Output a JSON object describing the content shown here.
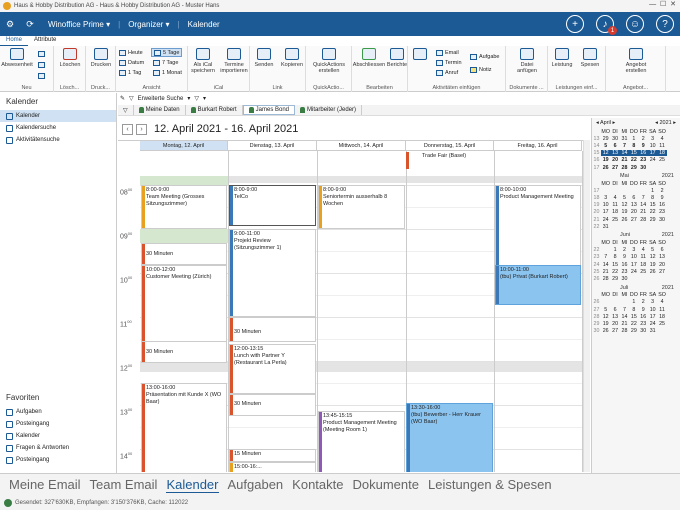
{
  "window": {
    "title": "Haus & Hobby Distribution AG - Haus & Hobby Distribution AG - Muster Hans"
  },
  "appbar": {
    "app": "Winoffice Prime",
    "section": "Organizer",
    "view": "Kalender",
    "notif_count": "1"
  },
  "ribbon_tabs": [
    "Home",
    "Attribute"
  ],
  "ribbon": {
    "neu": {
      "label": "Neu",
      "btn1": "Abwesenheit"
    },
    "losch": {
      "label": "Lösch...",
      "btn1": "Löschen"
    },
    "druck": {
      "label": "Druck...",
      "btn1": "Drucken"
    },
    "ansicht": {
      "label": "Ansicht",
      "items": [
        "Heute",
        "Datum",
        "1 Tag",
        "5 Tage",
        "7 Tage",
        "1 Monat"
      ]
    },
    "ical": {
      "label": "iCal",
      "btn1": "Als iCal speichern",
      "btn2": "Termine importieren"
    },
    "link": {
      "label": "Link",
      "btn1": "Senden",
      "btn2": "Kopieren"
    },
    "quickactions": {
      "label": "QuickActio...",
      "btn1": "QuickActions erstellen"
    },
    "bearbeiten": {
      "label": "Bearbeiten",
      "btn1": "Abschliessen",
      "btn2": "Berichte"
    },
    "aktivitaeten": {
      "label": "Aktivitäten einfügen",
      "items": [
        "Email",
        "Termin",
        "Anruf",
        "Aufgabe",
        "Notiz"
      ]
    },
    "dokumente": {
      "label": "Dokumente ...",
      "btn1": "Datei anfügen"
    },
    "leistungen": {
      "label": "Leistungen einf...",
      "btn1": "Leistung",
      "btn2": "Spesen"
    },
    "angebot": {
      "label": "Angebot...",
      "btn1": "Angebot erstellen"
    }
  },
  "toolbar": {
    "search": "Erweiterte Suche"
  },
  "filters": [
    "Meine Daten",
    "Burkart Robert",
    "James Bond",
    "Mitarbeiter (Jeder)"
  ],
  "sidebar": {
    "title": "Kalender",
    "items": [
      "Kalender",
      "Kalendersuche",
      "Aktivitätensuche"
    ],
    "fav_title": "Favoriten",
    "favs": [
      "Aufgaben",
      "Posteingang",
      "Kalender",
      "Fragen & Antworten",
      "Posteingang"
    ]
  },
  "calendar": {
    "range": "12. April 2021 - 16. April 2021",
    "days": [
      "Montag, 12. April",
      "Dienstag, 13. April",
      "Mittwoch, 14. April",
      "Donnerstag, 15. April",
      "Freitag, 16. April"
    ],
    "hours": [
      "08",
      "09",
      "10",
      "11",
      "12",
      "13",
      "14"
    ],
    "events": {
      "e1": {
        "time": "8:00-9:00",
        "text": "Team Meeting (Grosses Sitzungszimmer)"
      },
      "e2": {
        "time": "8:00-9:00",
        "text": "TelCo"
      },
      "e3": {
        "time": "8:00-9:00",
        "text": "Seniortermin ausserhalb 8 Wochen"
      },
      "e4": {
        "time": "8:00-10:00",
        "text": "Product Management Meeting"
      },
      "e5": {
        "time": "9:00-11:00",
        "text": "Projekt Review (Sitzungszimmer 1)"
      },
      "e6": {
        "text": "30 Minuten"
      },
      "e7": {
        "time": "10:00-12:00",
        "text": "Customer Meeting (Zürich)"
      },
      "e8": {
        "time": "10:00-11:00",
        "text": "(tbu) Privat (Burkart Robert)"
      },
      "e9": {
        "text": "30 Minuten"
      },
      "e10": {
        "time": "12:00-13:15",
        "text": "Lunch with Partner Y (Restaurant La Perla)"
      },
      "e11": {
        "text": "30 Minuten"
      },
      "e12": {
        "time": "13:00-16:00",
        "text": "Präsentation mit Kunde X (WO Baar)"
      },
      "e13": {
        "text": "30 Minuten"
      },
      "e14": {
        "time": "13:30-16:00",
        "text": "(tbu) Bewerber - Herr Krauer (WO Baar)"
      },
      "e15": {
        "time": "13:45-15:15",
        "text": "Product Management Meeting (Meeting Room 1)"
      },
      "e16": {
        "text": "15 Minuten"
      },
      "e17": {
        "time": "15:00-16:..."
      },
      "e18": {
        "text": "Trade Fair (Basel)"
      }
    }
  },
  "minical": {
    "month": "April",
    "year": "2021",
    "weekdays": [
      "MO",
      "DI",
      "MI",
      "DO",
      "FR",
      "SA",
      "SO"
    ],
    "months": [
      {
        "name": "April",
        "year": "2021",
        "rows": [
          [
            "13",
            "29",
            "30",
            "31",
            "1",
            "2",
            "3",
            "4"
          ],
          [
            "14",
            "5",
            "6",
            "7",
            "8",
            "9",
            "10",
            "11"
          ],
          [
            "15",
            "12",
            "13",
            "14",
            "15",
            "16",
            "17",
            "18"
          ],
          [
            "16",
            "19",
            "20",
            "21",
            "22",
            "23",
            "24",
            "25"
          ],
          [
            "17",
            "26",
            "27",
            "28",
            "29",
            "30",
            "",
            ""
          ]
        ]
      },
      {
        "name": "Mai",
        "year": "2021",
        "rows": [
          [
            "17",
            "",
            "",
            "",
            "",
            "",
            "1",
            "2"
          ],
          [
            "18",
            "3",
            "4",
            "5",
            "6",
            "7",
            "8",
            "9"
          ],
          [
            "19",
            "10",
            "11",
            "12",
            "13",
            "14",
            "15",
            "16"
          ],
          [
            "20",
            "17",
            "18",
            "19",
            "20",
            "21",
            "22",
            "23"
          ],
          [
            "21",
            "24",
            "25",
            "26",
            "27",
            "28",
            "29",
            "30"
          ],
          [
            "22",
            "31",
            "",
            "",
            "",
            "",
            "",
            ""
          ]
        ]
      },
      {
        "name": "Juni",
        "year": "2021",
        "rows": [
          [
            "22",
            "",
            "1",
            "2",
            "3",
            "4",
            "5",
            "6"
          ],
          [
            "23",
            "7",
            "8",
            "9",
            "10",
            "11",
            "12",
            "13"
          ],
          [
            "24",
            "14",
            "15",
            "16",
            "17",
            "18",
            "19",
            "20"
          ],
          [
            "25",
            "21",
            "22",
            "23",
            "24",
            "25",
            "26",
            "27"
          ],
          [
            "26",
            "28",
            "29",
            "30",
            "",
            "",
            "",
            ""
          ]
        ]
      },
      {
        "name": "Juli",
        "year": "2021",
        "rows": [
          [
            "26",
            "",
            "",
            "",
            "1",
            "2",
            "3",
            "4"
          ],
          [
            "27",
            "5",
            "6",
            "7",
            "8",
            "9",
            "10",
            "11"
          ],
          [
            "28",
            "12",
            "13",
            "14",
            "15",
            "16",
            "17",
            "18"
          ],
          [
            "29",
            "19",
            "20",
            "21",
            "22",
            "23",
            "24",
            "25"
          ],
          [
            "30",
            "26",
            "27",
            "28",
            "29",
            "30",
            "31",
            ""
          ]
        ]
      }
    ]
  },
  "bottomnav": [
    "Meine Email",
    "Team Email",
    "Kalender",
    "Aufgaben",
    "Kontakte",
    "Dokumente",
    "Leistungen & Spesen"
  ],
  "status": {
    "text": "Gesendet: 327'630KB, Empfangen: 3'150'376KB, Cache: 112022"
  }
}
